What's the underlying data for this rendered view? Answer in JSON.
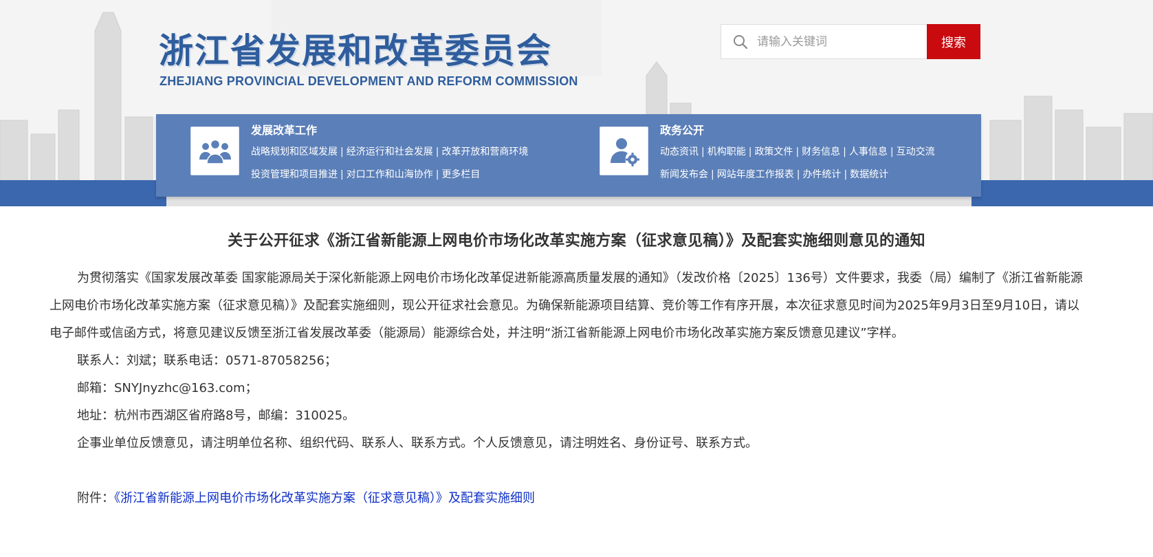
{
  "header": {
    "logo_cn": "浙江省发展和改革委员会",
    "logo_en": "ZHEJIANG PROVINCIAL DEVELOPMENT AND REFORM COMMISSION"
  },
  "search": {
    "placeholder": "请输入关键词",
    "button_label": "搜索"
  },
  "nav": {
    "left": {
      "icon": "group-people-icon",
      "title": "发展改革工作",
      "line1": [
        "战略规划和区域发展",
        "经济运行和社会发展",
        "改革开放和营商环境"
      ],
      "line2": [
        "投资管理和项目推进",
        "对口工作和山海协作",
        "更多栏目"
      ]
    },
    "right": {
      "icon": "user-gear-icon",
      "title": "政务公开",
      "line1": [
        "动态资讯",
        "机构职能",
        "政策文件",
        "财务信息",
        "人事信息",
        "互动交流"
      ],
      "line2": [
        "新闻发布会",
        "网站年度工作报表",
        "办件统计",
        "数据统计"
      ]
    },
    "separator": "|"
  },
  "article": {
    "title": "关于公开征求《浙江省新能源上网电价市场化改革实施方案（征求意见稿）》及配套实施细则意见的通知",
    "intro": "为贯彻落实《国家发展改革委 国家能源局关于深化新能源上网电价市场化改革促进新能源高质量发展的通知》（发改价格〔2025〕136号）文件要求，我委（局）编制了《浙江省新能源上网电价市场化改革实施方案（征求意见稿）》及配套实施细则，现公开征求社会意见。为确保新能源项目结算、竞价等工作有序开展，本次征求意见时间为2025年9月3日至9月10日，请以电子邮件或信函方式，将意见建议反馈至浙江省发展改革委（能源局）能源综合处，并注明“浙江省新能源上网电价市场化改革实施方案反馈意见建议”字样。",
    "contact": "联系人：刘斌；联系电话：0571-87058256；",
    "email": "邮箱：SNYJnyzhc@163.com；",
    "address": "地址：杭州市西湖区省府路8号，邮编：310025。",
    "note": "企事业单位反馈意见，请注明单位名称、组织代码、联系人、联系方式。个人反馈意见，请注明姓名、身份证号、联系方式。",
    "attachment_label": "附件：",
    "attachment_link": "《浙江省新能源上网电价市场化改革实施方案（征求意见稿）》及配套实施细则"
  },
  "colors": {
    "brand_blue": "#2f5d9d",
    "nav_blue": "#5b7fb8",
    "band_blue": "#3a67ad",
    "search_red": "#c90a0f",
    "link_blue": "#0e2fc6"
  }
}
